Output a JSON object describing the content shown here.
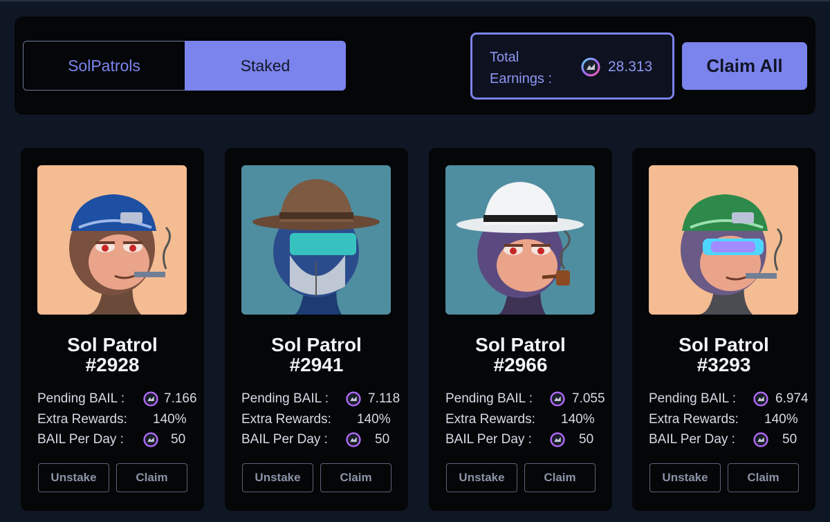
{
  "tabs": {
    "solpatrols": "SolPatrols",
    "staked": "Staked",
    "active": "Staked"
  },
  "earnings": {
    "label": "Total\nEarnings :",
    "value": "28.313",
    "icon": "bail-coin-icon"
  },
  "claim_all": "Claim All",
  "labels": {
    "pending": "Pending BAIL :",
    "extra": "Extra Rewards:",
    "per_day": "BAIL Per Day :",
    "unstake": "Unstake",
    "claim": "Claim"
  },
  "colors": {
    "accent": "#7b83ec",
    "background": "#0f1724",
    "panel": "#050608"
  },
  "cards": [
    {
      "name": "Sol Patrol",
      "number": "#2928",
      "pending": "7.166",
      "extra": "140%",
      "per_day": "50",
      "art": "ape-cyber-helmet-cigar"
    },
    {
      "name": "Sol Patrol",
      "number": "#2941",
      "pending": "7.118",
      "extra": "140%",
      "per_day": "50",
      "art": "ape-brown-hat-visor"
    },
    {
      "name": "Sol Patrol",
      "number": "#2966",
      "pending": "7.055",
      "extra": "140%",
      "per_day": "50",
      "art": "ape-white-hat-pipe"
    },
    {
      "name": "Sol Patrol",
      "number": "#3293",
      "pending": "6.974",
      "extra": "140%",
      "per_day": "50",
      "art": "ape-green-helmet-visor"
    }
  ]
}
